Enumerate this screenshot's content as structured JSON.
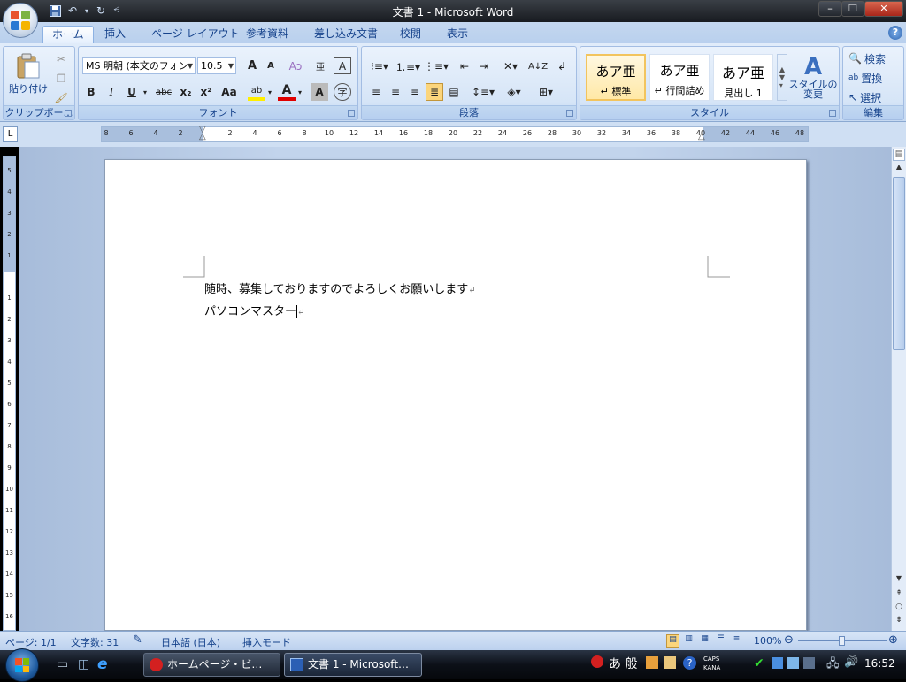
{
  "window": {
    "title": "文書 1 - Microsoft Word",
    "minimize": "–",
    "restore": "❐",
    "close": "✕"
  },
  "tabs": [
    {
      "label": "ホーム",
      "active": true
    },
    {
      "label": "挿入"
    },
    {
      "label": "ページ レイアウト"
    },
    {
      "label": "参考資料"
    },
    {
      "label": "差し込み文書"
    },
    {
      "label": "校閲"
    },
    {
      "label": "表示"
    }
  ],
  "help_icon": "?",
  "ribbon": {
    "clipboard": {
      "label": "クリップボー…",
      "paste": "貼り付け"
    },
    "font": {
      "label": "フォント",
      "font_name": "MS 明朝 (本文のフォン",
      "font_size": "10.5",
      "grow": "A",
      "shrink": "A",
      "bold": "B",
      "italic": "I",
      "underline": "U",
      "strike": "abc",
      "subscript": "x₂",
      "superscript": "x²",
      "case": "Aa",
      "highlight": "ab",
      "color": "A",
      "shade": "A",
      "border": "A",
      "enclose": "字"
    },
    "paragraph": {
      "label": "段落"
    },
    "styles": {
      "label": "スタイル",
      "items": [
        {
          "sample": "あア亜",
          "name": "↵ 標準"
        },
        {
          "sample": "あア亜",
          "name": "↵ 行間詰め"
        },
        {
          "sample": "あア亜",
          "name": "見出し 1"
        }
      ],
      "change": "スタイルの\n変更"
    },
    "editing": {
      "label": "編集",
      "find": "検索",
      "replace": "置換",
      "select": "選択"
    }
  },
  "ruler": {
    "tab_selector": "L",
    "h_ticks": [
      "8",
      "6",
      "4",
      "2",
      "",
      "2",
      "4",
      "6",
      "8",
      "10",
      "12",
      "14",
      "16",
      "18",
      "20",
      "22",
      "24",
      "26",
      "28",
      "30",
      "32",
      "34",
      "36",
      "38",
      "40",
      "42",
      "44",
      "46",
      "48"
    ],
    "v_ticks": [
      "5",
      "4",
      "3",
      "2",
      "1",
      "",
      "1",
      "2",
      "3",
      "4",
      "5",
      "6",
      "7",
      "8",
      "9",
      "10",
      "11",
      "12",
      "13",
      "14",
      "15",
      "16"
    ]
  },
  "document": {
    "lines": [
      "随時、募集しておりますのでよろしくお願いします",
      "パソコンマスター"
    ]
  },
  "statusbar": {
    "page": "ページ: 1/1",
    "words": "文字数: 31",
    "language": "日本語 (日本)",
    "mode": "挿入モード",
    "zoom": "100%",
    "zoom_level": 100
  },
  "taskbar": {
    "tasks": [
      {
        "label": "ホームページ・ビ…",
        "active": false
      },
      {
        "label": "文書 1 - Microsoft…",
        "active": true
      }
    ],
    "ime": "あ 般",
    "caps": "CAPS",
    "kana": "KANA",
    "clock": "16:52"
  }
}
